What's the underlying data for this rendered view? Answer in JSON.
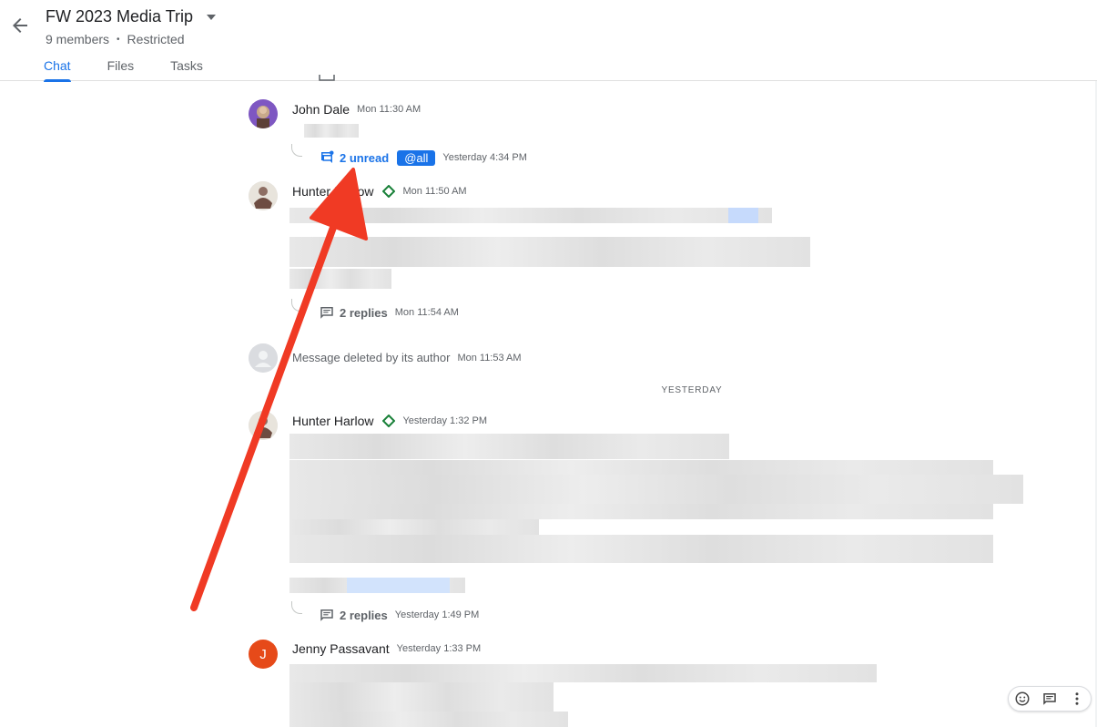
{
  "header": {
    "title": "FW 2023 Media Trip",
    "members": "9 members",
    "access": "Restricted",
    "separator": "•",
    "tabs": [
      {
        "label": "Chat",
        "active": true
      },
      {
        "label": "Files",
        "active": false
      },
      {
        "label": "Tasks",
        "active": false
      }
    ]
  },
  "messages": [
    {
      "author": "John Dale",
      "time": "Mon 11:30 AM",
      "thread": {
        "unread_label": "2 unread",
        "mention": "@all",
        "time": "Yesterday 4:34 PM"
      }
    },
    {
      "author": "Hunter Harlow",
      "time": "Mon 11:50 AM",
      "thread": {
        "label": "2 replies",
        "time": "Mon 11:54 AM"
      }
    },
    {
      "deleted_text": "Message deleted by its author",
      "time": "Mon 11:53 AM"
    },
    {
      "author": "Hunter Harlow",
      "time": "Yesterday 1:32 PM",
      "thread": {
        "label": "2 replies",
        "time": "Yesterday 1:49 PM"
      }
    },
    {
      "author": "Jenny Passavant",
      "avatar_initial": "J",
      "time": "Yesterday 1:33 PM"
    }
  ],
  "date_divider": "YESTERDAY",
  "colors": {
    "accent": "#1a73e8",
    "annotation_arrow": "#f03a24",
    "jenny_avatar": "#e64a19",
    "bot_badge": "#188038"
  },
  "icons": [
    "back-arrow-icon",
    "dropdown-caret-icon",
    "thread-reply-icon",
    "unread-thread-icon",
    "bot-diamond-icon",
    "emoji-icon",
    "reply-in-thread-icon",
    "more-vert-icon"
  ]
}
